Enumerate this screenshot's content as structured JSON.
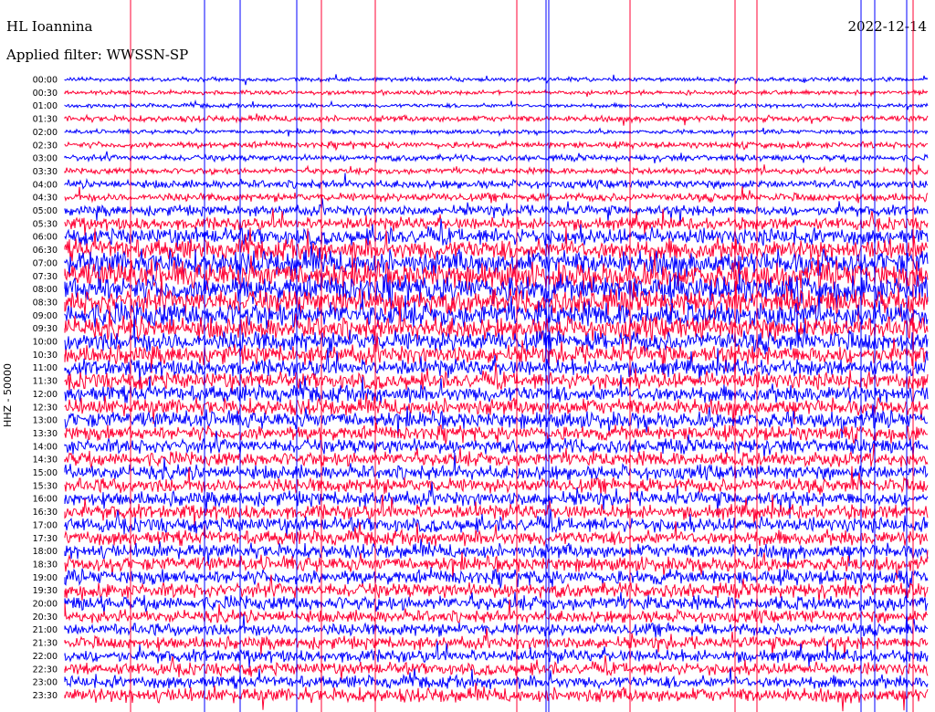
{
  "header": {
    "station": "HL Ioannina",
    "filter": "Applied filter: WWSSN-SP",
    "date": "2022-12-14",
    "ylabel": "HHZ - 50000"
  },
  "colors": {
    "blue": "#0000ff",
    "red": "#ff0033"
  },
  "chart_data": {
    "type": "line",
    "title": "HL Ioannina",
    "subtitle": "Applied filter: WWSSN-SP",
    "ylabel": "HHZ - 50000",
    "xlabel": "",
    "row_labels": [
      "00:00",
      "00:30",
      "01:00",
      "01:30",
      "02:00",
      "02:30",
      "03:00",
      "03:30",
      "04:00",
      "04:30",
      "05:00",
      "05:30",
      "06:00",
      "06:30",
      "07:00",
      "07:30",
      "08:00",
      "08:30",
      "09:00",
      "09:30",
      "10:00",
      "10:30",
      "11:00",
      "11:30",
      "12:00",
      "12:30",
      "13:00",
      "13:30",
      "14:00",
      "14:30",
      "15:00",
      "15:30",
      "16:00",
      "16:30",
      "17:00",
      "17:30",
      "18:00",
      "18:30",
      "19:00",
      "19:30",
      "20:00",
      "20:30",
      "21:00",
      "21:30",
      "22:00",
      "22:30",
      "23:00",
      "23:30"
    ],
    "row_colors": [
      "blue",
      "red"
    ],
    "row_amplitude": [
      2,
      2,
      2,
      3,
      2,
      3,
      3,
      3,
      4,
      4,
      5,
      6,
      8,
      10,
      12,
      13,
      13,
      12,
      12,
      11,
      10,
      9,
      8,
      8,
      8,
      8,
      8,
      7,
      7,
      7,
      7,
      7,
      7,
      7,
      7,
      7,
      7,
      7,
      7,
      7,
      7,
      6,
      6,
      6,
      6,
      6,
      6,
      7
    ],
    "grid": false,
    "legend": "none"
  }
}
